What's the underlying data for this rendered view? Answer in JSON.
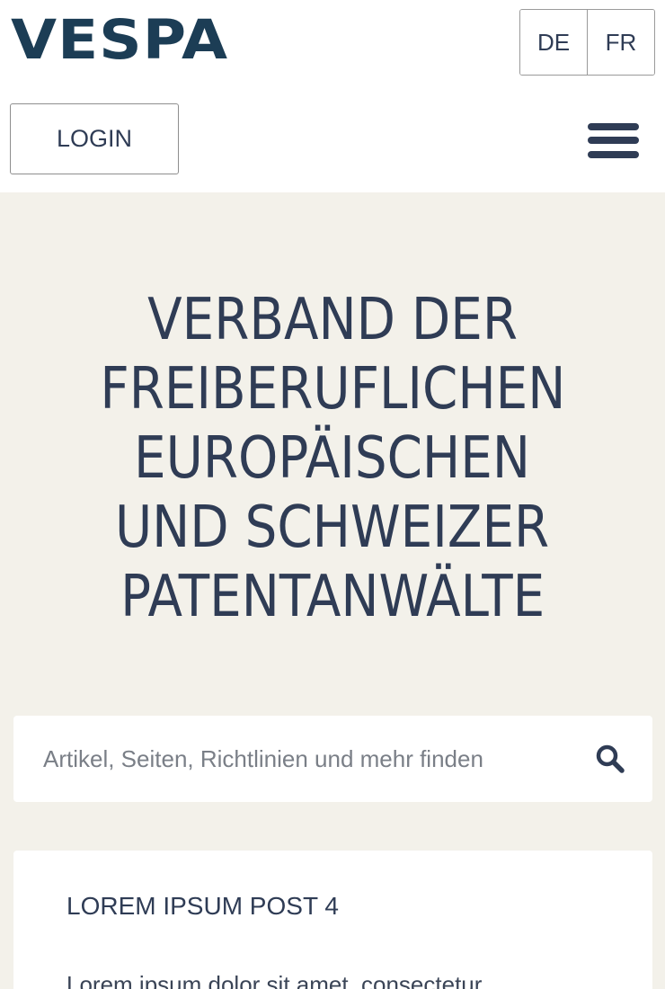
{
  "header": {
    "logo": "VESPA",
    "languages": [
      "DE",
      "FR"
    ],
    "login_label": "LOGIN"
  },
  "hero": {
    "title_lines": [
      "VERBAND DER",
      "FREIBERUFLICHEN",
      "EUROPÄISCHEN",
      "UND SCHWEIZER",
      "PATENTANWÄLTE"
    ]
  },
  "search": {
    "placeholder": "Artikel, Seiten, Richtlinien und mehr finden",
    "value": ""
  },
  "post": {
    "title": "LOREM IPSUM POST 4",
    "excerpt": "Lorem ipsum dolor sit amet, consectetur"
  },
  "colors": {
    "logo": "#1c3d55",
    "text": "#2f3c55",
    "hero_background": "#f3f1ea"
  }
}
